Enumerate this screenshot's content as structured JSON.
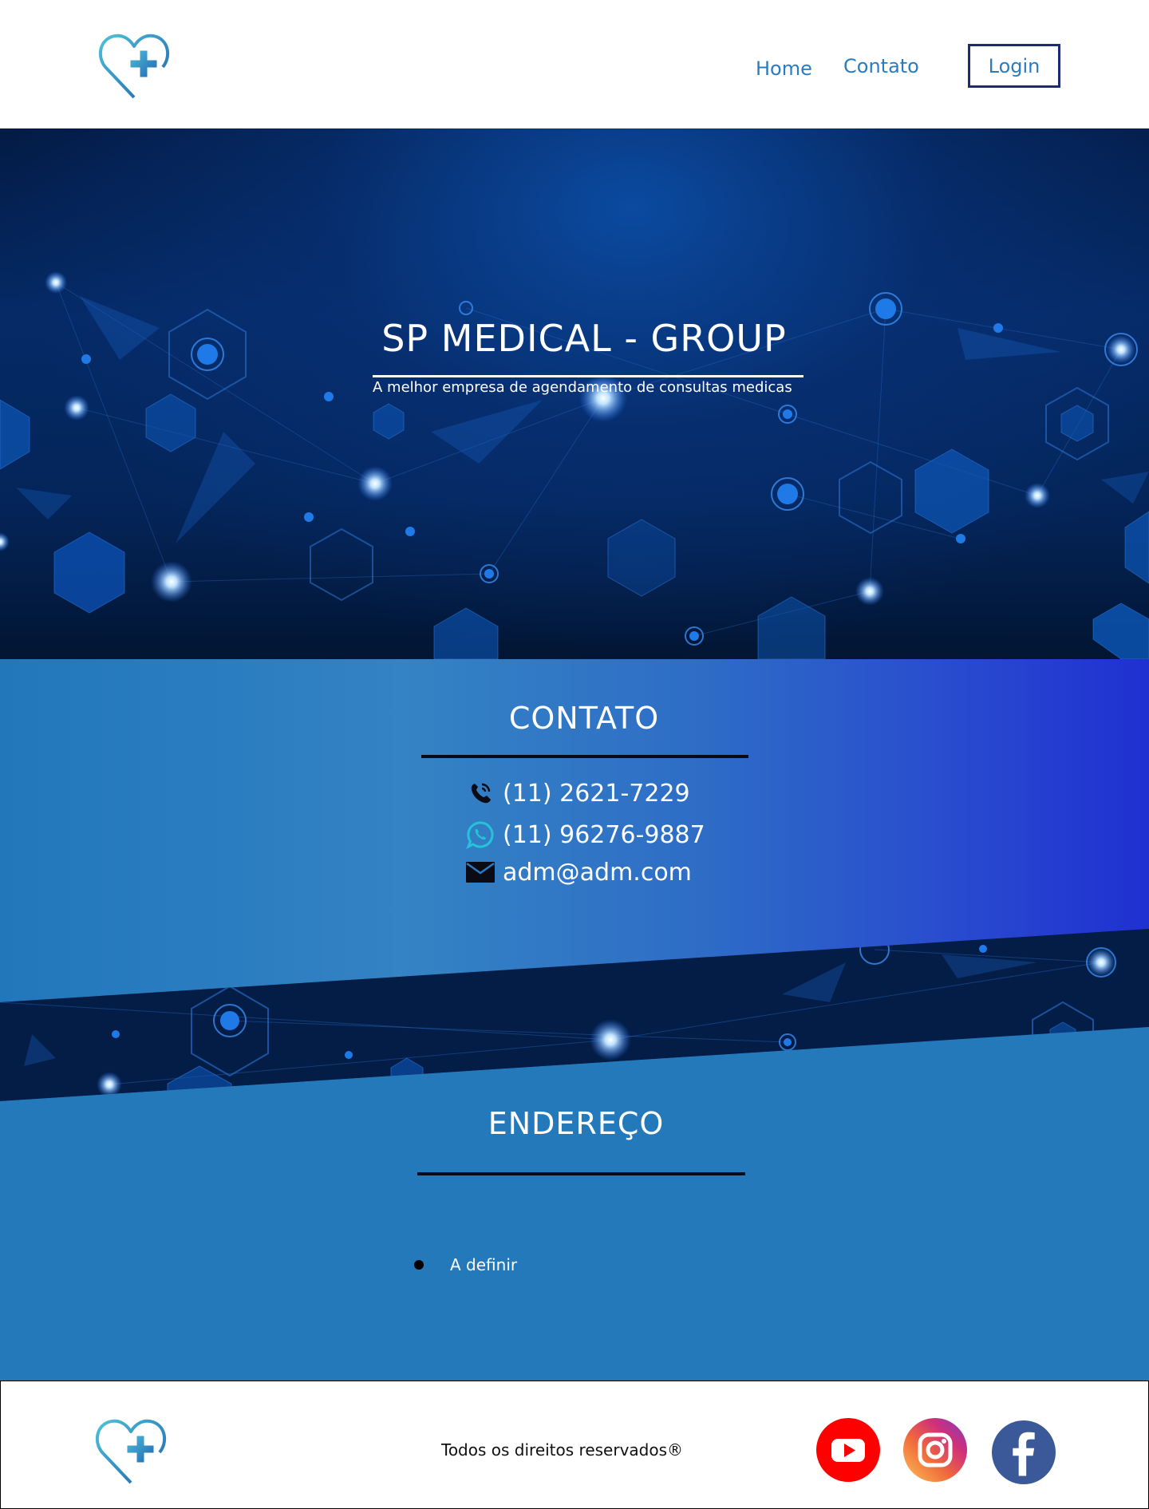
{
  "header": {
    "logo_icon": "heart-plus-icon",
    "nav": {
      "home": "Home",
      "contato": "Contato"
    },
    "login_label": "Login"
  },
  "hero": {
    "title": "SP MEDICAL - GROUP",
    "subtitle": "A melhor empresa de agendamento de consultas medicas"
  },
  "contact": {
    "title": "CONTATO",
    "items": [
      {
        "icon": "phone-icon",
        "text": "(11) 2621-7229"
      },
      {
        "icon": "whatsapp-icon",
        "text": "(11) 96276-9887"
      },
      {
        "icon": "mail-icon",
        "text": "adm@adm.com"
      }
    ]
  },
  "address": {
    "title": "ENDEREÇO",
    "items": [
      "A definir"
    ]
  },
  "footer": {
    "text": "Todos os direitos reservados®",
    "social": [
      "youtube-icon",
      "instagram-icon",
      "facebook-icon"
    ]
  },
  "colors": {
    "accent": "#2a7cbf",
    "hero_dark": "#031b45",
    "contact_left": "#2277bb",
    "contact_right": "#1f30d1",
    "youtube": "#ff0000",
    "facebook": "#3b5998"
  }
}
